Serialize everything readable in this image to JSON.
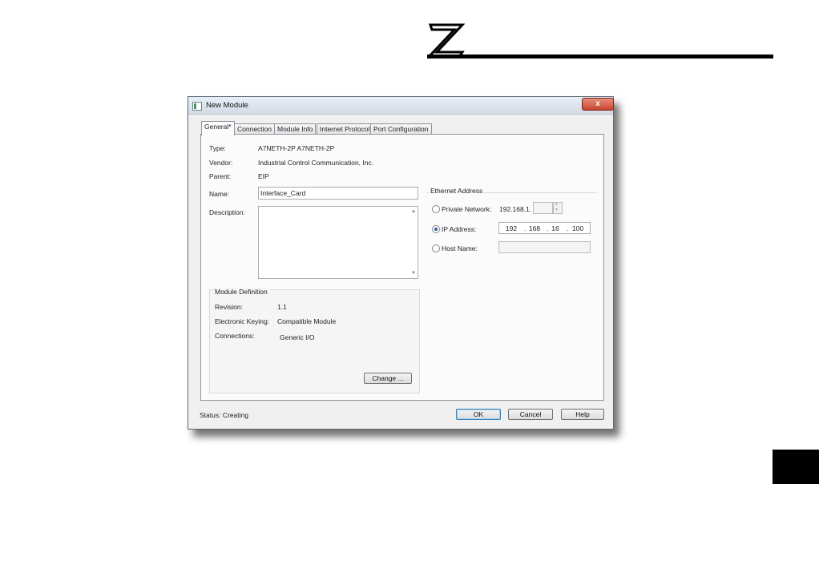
{
  "window": {
    "title": "New Module",
    "close_glyph": "x"
  },
  "tabs": [
    {
      "label": "General*"
    },
    {
      "label": "Connection"
    },
    {
      "label": "Module Info"
    },
    {
      "label": "Internet Protocol"
    },
    {
      "label": "Port Configuration"
    }
  ],
  "general": {
    "type_label": "Type:",
    "type_value": "A7NETH-2P A7NETH-2P",
    "vendor_label": "Vendor:",
    "vendor_value": "Industrial Control  Communication, Inc.",
    "parent_label": "Parent:",
    "parent_value": "EIP",
    "name_label": "Name:",
    "name_value": "Interface_Card",
    "description_label": "Description:",
    "description_value": ""
  },
  "module_definition": {
    "title": "Module Definition",
    "revision_label": "Revision:",
    "revision_value": "1.1",
    "keying_label": "Electronic Keying:",
    "keying_value": "Compatible Module",
    "connections_label": "Connections:",
    "connections_value": "Generic I/O",
    "change_button": "Change ..."
  },
  "ethernet": {
    "title": "Ethernet Address",
    "private_network_label": "Private Network:",
    "private_network_prefix": "192.168.1.",
    "ip_address_label": "IP Address:",
    "ip_octets": [
      "192",
      "168",
      "16",
      "100"
    ],
    "host_name_label": "Host Name:",
    "selected": "ip_address"
  },
  "footer": {
    "status": "Status:  Creating",
    "ok_button": "OK",
    "cancel_button": "Cancel",
    "help_button": "Help"
  }
}
